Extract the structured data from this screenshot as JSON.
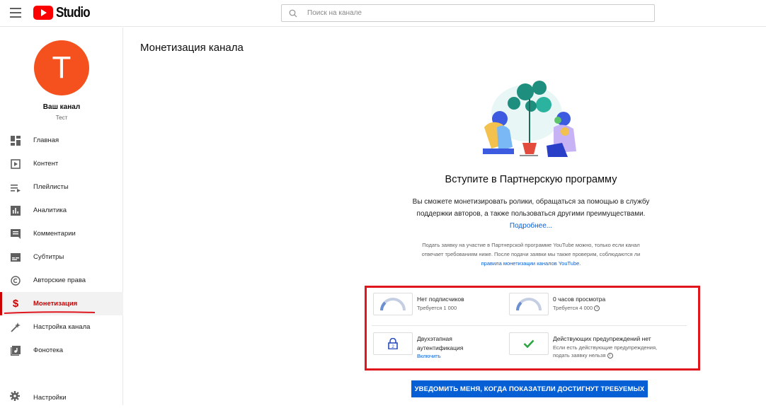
{
  "header": {
    "logo_text": "Studio",
    "search_placeholder": "Поиск на канале"
  },
  "channel": {
    "avatar_letter": "T",
    "title": "Ваш канал",
    "subtitle": "Тест"
  },
  "sidebar": {
    "items": [
      {
        "label": "Главная",
        "icon": "dashboard-icon"
      },
      {
        "label": "Контент",
        "icon": "content-icon"
      },
      {
        "label": "Плейлисты",
        "icon": "playlist-icon"
      },
      {
        "label": "Аналитика",
        "icon": "analytics-icon"
      },
      {
        "label": "Комментарии",
        "icon": "comments-icon"
      },
      {
        "label": "Субтитры",
        "icon": "subtitles-icon"
      },
      {
        "label": "Авторские права",
        "icon": "copyright-icon"
      },
      {
        "label": "Монетизация",
        "icon": "dollar-icon",
        "active": true
      },
      {
        "label": "Настройка канала",
        "icon": "magic-wand-icon"
      },
      {
        "label": "Фонотека",
        "icon": "audio-library-icon"
      }
    ],
    "settings_label": "Настройки"
  },
  "main": {
    "page_title": "Монетизация канала",
    "program_title": "Вступите в Партнерскую программу",
    "program_desc": "Вы сможете монетизировать ролики, обращаться за помощью в службу поддержки авторов, а также пользоваться другими преимуществами.",
    "learn_more": "Подробнее...",
    "note": "Подать заявку на участие в Партнерской программе YouTube можно, только если канал отвечает требованиям ниже. После подачи заявки мы также проверим, соблюдаются ли",
    "note_link": "правила монетизации каналов YouTube.",
    "requirements": [
      {
        "title": "Нет подписчиков",
        "detail": "Требуется 1 000",
        "icon": "gauge-icon"
      },
      {
        "title": "0 часов просмотра",
        "detail": "Требуется 4 000",
        "icon": "gauge-icon"
      },
      {
        "title_line1": "Двухэтапная",
        "title_line2": "аутентификация",
        "link": "Включить",
        "icon": "lock-icon"
      },
      {
        "title": "Действующих предупреждений нет",
        "detail_line1": "Если есть действующие предупреждения,",
        "detail_line2": "подать заявку нельзя",
        "icon": "checkmark-icon"
      }
    ],
    "notify_button": "УВЕДОМИТЬ МЕНЯ, КОГДА ПОКАЗАТЕЛИ ДОСТИГНУТ ТРЕБУЕМЫХ"
  },
  "colors": {
    "accent_red": "#cc0000",
    "link_blue": "#065fd4",
    "avatar": "#f4511e",
    "highlight_box": "#e0161e",
    "check_green": "#2ba640"
  }
}
